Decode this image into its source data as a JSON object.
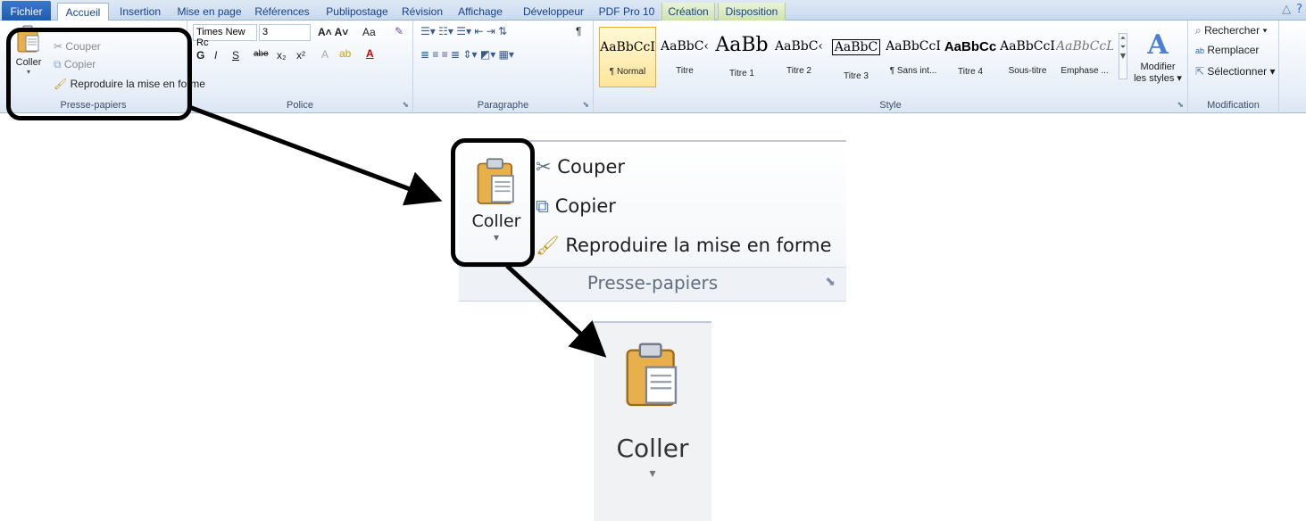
{
  "tabs": [
    "Fichier",
    "Accueil",
    "Insertion",
    "Mise en page",
    "Références",
    "Publipostage",
    "Révision",
    "Affichage",
    "Développeur",
    "PDF Pro 10",
    "Création",
    "Disposition"
  ],
  "clipboard": {
    "paste": "Coller",
    "cut": "Couper",
    "copy": "Copier",
    "format_painter": "Reproduire la mise en forme",
    "group_label": "Presse-papiers"
  },
  "font": {
    "name": "Times New Rc",
    "size": "3",
    "group_label": "Police",
    "bold": "G",
    "italic": "I",
    "underline": "S",
    "strike": "abe",
    "sub": "x₂",
    "sup": "x²",
    "change_case": "Aa"
  },
  "paragraph": {
    "group_label": "Paragraphe",
    "pilcrow": "¶"
  },
  "styles": {
    "group_label": "Style",
    "items": [
      {
        "preview": "AaBbCcI",
        "name": "¶ Normal"
      },
      {
        "preview": "AaBbC‹",
        "name": "Titre"
      },
      {
        "preview": "AaBb",
        "name": "Titre 1"
      },
      {
        "preview": "AaBbC‹",
        "name": "Titre 2"
      },
      {
        "preview": "AaBbC",
        "name": "Titre 3"
      },
      {
        "preview": "AaBbCcI",
        "name": "¶ Sans int..."
      },
      {
        "preview": "AaBbCc",
        "name": "Titre 4"
      },
      {
        "preview": "AaBbCcI",
        "name": "Sous-titre"
      },
      {
        "preview": "AaBbCcL",
        "name": "Emphase ..."
      }
    ],
    "modify_line1": "Modifier",
    "modify_line2": "les styles ▾"
  },
  "editing": {
    "group_label": "Modification",
    "find": "Rechercher ▾",
    "replace": "Remplacer",
    "select": "Sélectionner ▾"
  },
  "colors": {
    "accent": "#15428b",
    "file_tab": "#2a67bd",
    "callout": "#000000"
  },
  "icons": [
    "paste-icon",
    "scissors-icon",
    "copy-icon",
    "format-painter-icon",
    "arrow-icon",
    "find-icon",
    "replace-icon",
    "select-icon"
  ]
}
